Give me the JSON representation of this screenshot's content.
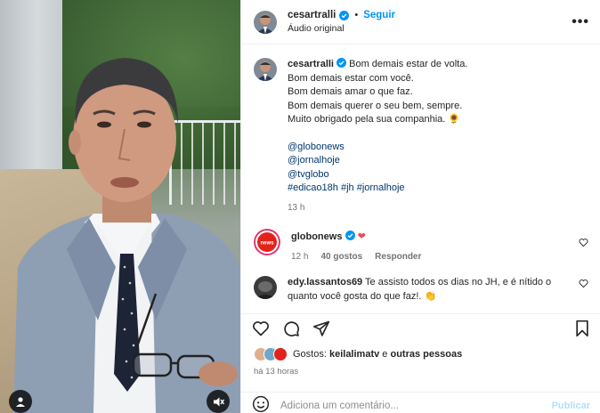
{
  "header": {
    "username": "cesartralli",
    "separator": "•",
    "follow_label": "Seguir",
    "audio_label": "Áudio original",
    "more_label": "•••"
  },
  "caption": {
    "username": "cesartralli",
    "lines": [
      "Bom demais estar de volta.",
      "Bom demais estar com você.",
      "Bom demais amar o que faz.",
      "Bom demais querer o seu bem, sempre.",
      "Muito obrigado pela sua companhia. 🌻"
    ],
    "mentions": [
      "@globonews",
      "@jornalhoje",
      "@tvglobo"
    ],
    "hashtags": [
      "#edicao18h",
      "#jh",
      "#jornalhoje"
    ],
    "time": "13 h"
  },
  "comments": [
    {
      "username": "globonews",
      "text": "❤",
      "time": "12 h",
      "likes": "40 gostos",
      "reply": "Responder"
    },
    {
      "username": "edy.lassantos69",
      "text": "Te assisto todos os dias no JH, e é nítido o quanto você gosta do que faz!. 👏"
    }
  ],
  "likes_line": {
    "prefix": "Gostos:",
    "user": "keilalimatv",
    "connector": "e",
    "others": "outras pessoas"
  },
  "post_age": "há 13 horas",
  "add_comment": {
    "placeholder": "Adiciona um comentário...",
    "publish": "Publicar"
  },
  "colors": {
    "link": "#0095f6",
    "mention": "#00376b",
    "heart_red": "#ed4956",
    "globonews_red": "#e2231a"
  }
}
